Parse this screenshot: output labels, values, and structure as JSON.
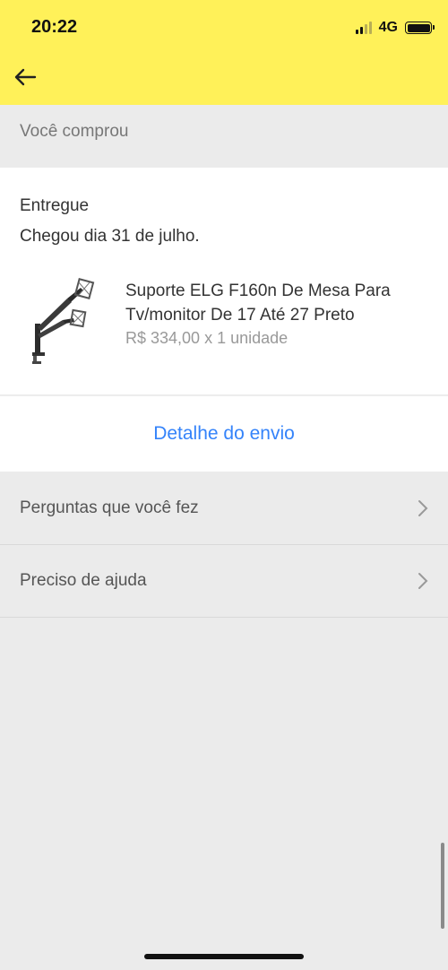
{
  "status_bar": {
    "time": "20:22",
    "network": "4G"
  },
  "section": {
    "title": "Você comprou"
  },
  "order": {
    "status": "Entregue",
    "arrival": "Chegou dia 31 de julho.",
    "product": {
      "title": "Suporte ELG F160n De Mesa Para Tv/monitor De 17  Até 27  Preto",
      "price_line": "R$ 334,00 x 1 unidade"
    }
  },
  "actions": {
    "shipping_detail": "Detalhe do envio"
  },
  "menu": [
    {
      "label": "Perguntas que você fez",
      "icon": "chevron-right-icon"
    },
    {
      "label": "Preciso de ajuda",
      "icon": "chevron-right-icon"
    }
  ],
  "colors": {
    "header": "#fff159",
    "link": "#3483fa",
    "background": "#ebebeb"
  }
}
